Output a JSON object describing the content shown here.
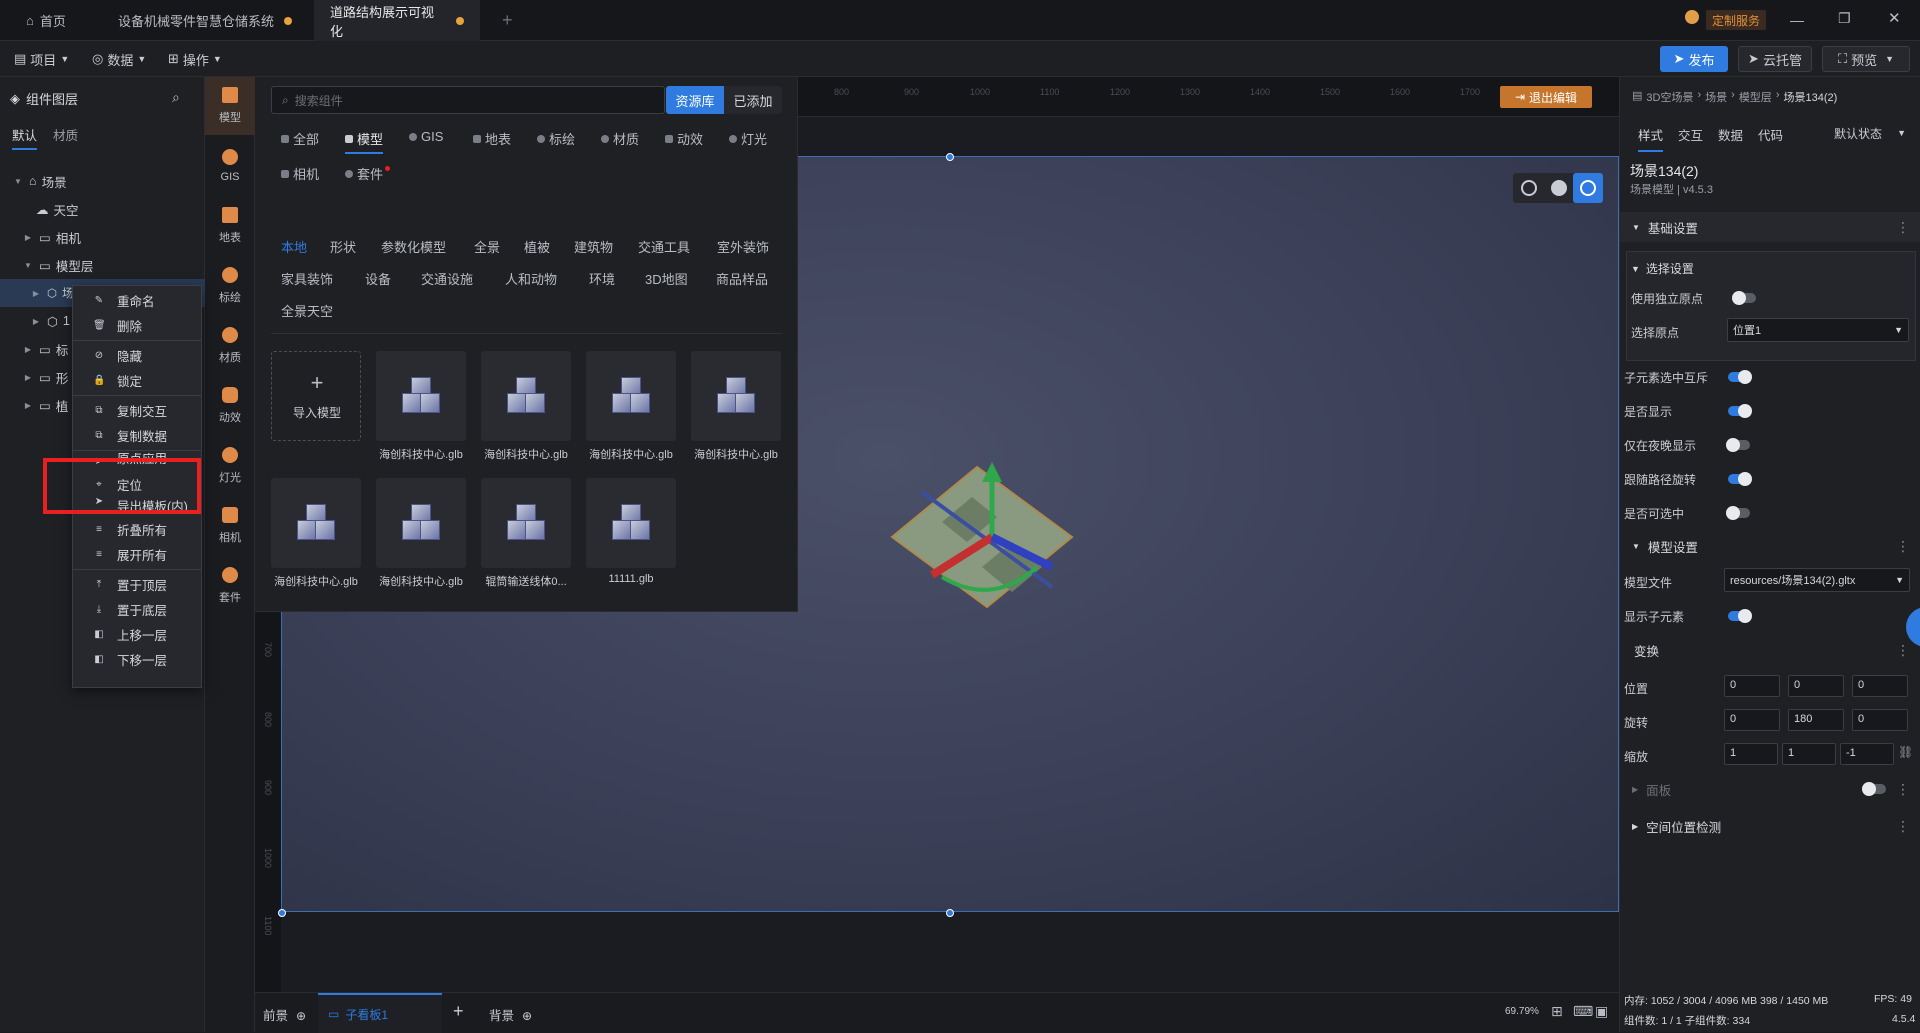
{
  "tabs": [
    {
      "label": "首页"
    },
    {
      "label": "设备机械零件智慧仓储系统"
    },
    {
      "label": "道路结构展示可视化"
    }
  ],
  "titlebar": {
    "service": "定制服务"
  },
  "toolbar": {
    "project": "项目",
    "data": "数据",
    "operate": "操作",
    "publish": "发布",
    "cloud": "云托管",
    "preview": "预览"
  },
  "layers": {
    "title": "组件图层",
    "tab_default": "默认",
    "tab_material": "材质",
    "items": [
      {
        "label": "场景"
      },
      {
        "label": "天空"
      },
      {
        "label": "相机"
      },
      {
        "label": "模型层"
      },
      {
        "label": "场景134(2)"
      },
      {
        "label": "1"
      },
      {
        "label": "标"
      },
      {
        "label": "形"
      },
      {
        "label": "植"
      }
    ]
  },
  "context_menu": {
    "items": [
      "重命名",
      "删除",
      "隐藏",
      "锁定",
      "复制交互",
      "复制数据",
      "原点应用",
      "定位",
      "导出模板(内)",
      "折叠所有",
      "展开所有",
      "置于顶层",
      "置于底层",
      "上移一层",
      "下移一层"
    ]
  },
  "iconcol": {
    "items": [
      "模型",
      "GIS",
      "地表",
      "标绘",
      "材质",
      "动效",
      "灯光",
      "相机",
      "套件"
    ]
  },
  "library": {
    "search_placeholder": "搜索组件",
    "btn_repo": "资源库",
    "btn_added": "已添加",
    "categories": [
      "全部",
      "模型",
      "GIS",
      "地表",
      "标绘",
      "材质",
      "动效",
      "灯光",
      "相机",
      "套件"
    ],
    "subcategories": [
      "本地",
      "形状",
      "参数化模型",
      "全景",
      "植被",
      "建筑物",
      "交通工具",
      "室外装饰",
      "家具装饰",
      "设备",
      "交通设施",
      "人和动物",
      "环境",
      "3D地图",
      "商品样品",
      "全景天空"
    ],
    "import_label": "导入模型",
    "models": [
      "海创科技中心.glb",
      "海创科技中心.glb",
      "海创科技中心.glb",
      "海创科技中心.glb",
      "海创科技中心.glb",
      "海创科技中心.glb",
      "辊筒输送线体0...",
      "11111.glb"
    ]
  },
  "canvas": {
    "exit_edit": "退出编辑",
    "ruler_ticks": [
      "800",
      "900",
      "1000",
      "1100",
      "1200",
      "1300",
      "1400",
      "1500",
      "1600",
      "1700"
    ],
    "left_ruler": [
      "700",
      "800",
      "900",
      "1000",
      "1100"
    ]
  },
  "bottombar": {
    "front": "前景",
    "subboard": "子看板1",
    "background": "背景",
    "zoom": "69.79%"
  },
  "rightpanel": {
    "breadcrumb": [
      "3D空场景",
      "场景",
      "模型层",
      "场景134(2)"
    ],
    "tabs": [
      "样式",
      "交互",
      "数据",
      "代码"
    ],
    "state": "默认状态",
    "name": "场景134(2)",
    "subtitle": "场景模型 | v4.5.3",
    "basic": "基础设置",
    "select": "选择设置",
    "use_own_origin": "使用独立原点",
    "select_origin": "选择原点",
    "origin_value": "位置1",
    "child_exclusive": "子元素选中互斥",
    "visible": "是否显示",
    "night_only": "仅在夜晚显示",
    "follow_path": "跟随路径旋转",
    "selectable": "是否可选中",
    "model_settings": "模型设置",
    "model_file": "模型文件",
    "model_file_value": "resources/场景134(2).gltx",
    "show_children": "显示子元素",
    "transform": "变换",
    "position": "位置",
    "pos": [
      "0",
      "0",
      "0"
    ],
    "rotation": "旋转",
    "rot": [
      "0",
      "180",
      "0"
    ],
    "scale": "缩放",
    "scl": [
      "1",
      "1",
      "-1"
    ],
    "panel": "面板",
    "space_check": "空间位置检测",
    "status1": "内存: 1052 / 3004 / 4096 MB  398 / 1450 MB",
    "fps": "FPS: 49",
    "status2": "组件数: 1 / 1  子组件数: 334",
    "version": "4.5.4"
  },
  "colors": {
    "accent": "#2f7be0",
    "highlight": "#e8201f",
    "orange": "#e08a4a"
  }
}
